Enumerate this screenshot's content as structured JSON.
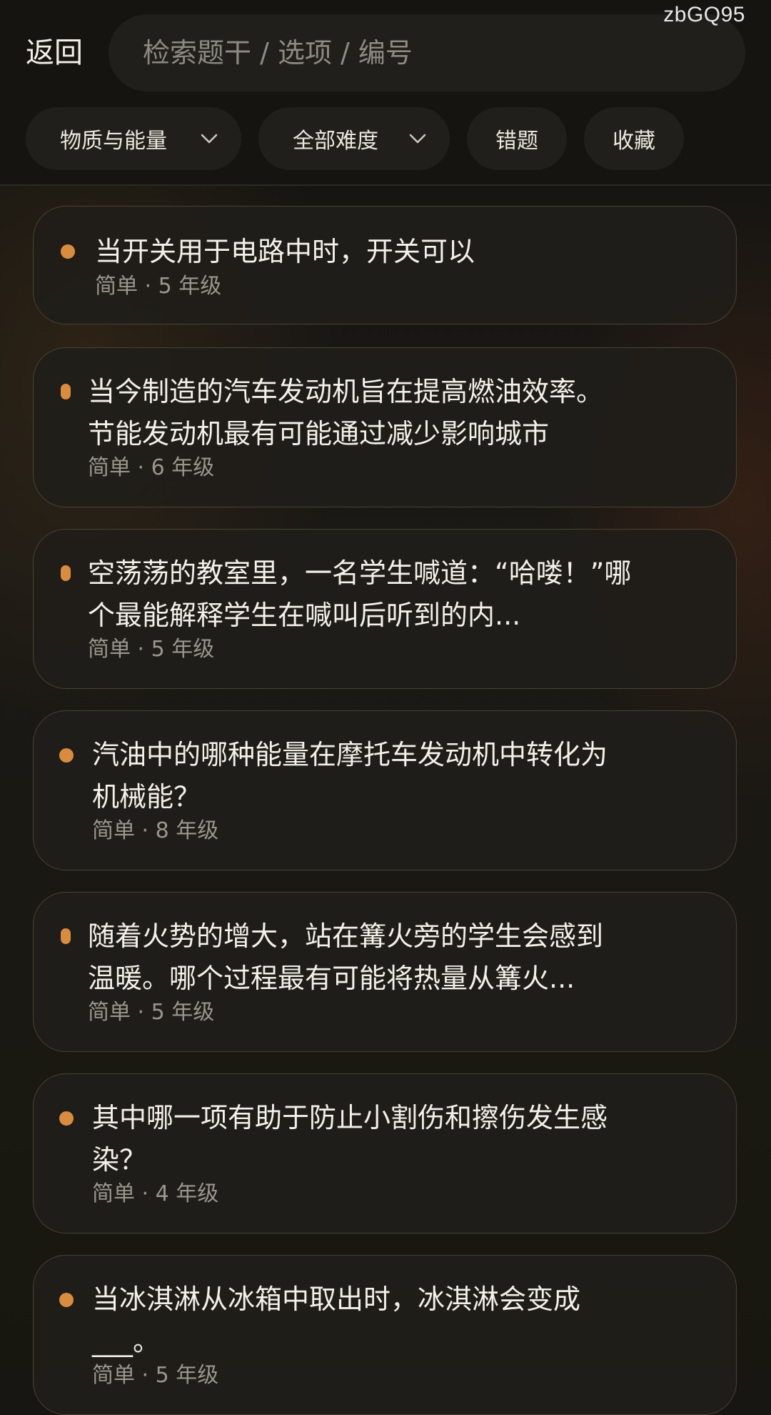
{
  "watermark": "zbGQ95",
  "header": {
    "back_label": "返回",
    "search_placeholder": "检索题干 / 选项 / 编号"
  },
  "filters": {
    "subject": "物质与能量",
    "difficulty": "全部难度",
    "wrong": "错题",
    "favorites": "收藏"
  },
  "questions": [
    {
      "line1": "当开关用于电路中时，开关可以",
      "line2": "",
      "meta": "简单 · 5 年级"
    },
    {
      "line1": "当今制造的汽车发动机旨在提高燃油效率。",
      "line2": "节能发动机最有可能通过减少影响城市",
      "meta": "简单 · 6 年级"
    },
    {
      "line1": "空荡荡的教室里，一名学生喊道：“哈喽！”哪",
      "line2": "个最能解释学生在喊叫后听到的内...",
      "meta": "简单 · 5 年级"
    },
    {
      "line1": "汽油中的哪种能量在摩托车发动机中转化为",
      "line2": "机械能？",
      "meta": "简单 · 8 年级"
    },
    {
      "line1": "随着火势的增大，站在篝火旁的学生会感到",
      "line2": "温暖。哪个过程最有可能将热量从篝火...",
      "meta": "简单 · 5 年级"
    },
    {
      "line1": "其中哪一项有助于防止小割伤和擦伤发生感",
      "line2": "染？",
      "meta": "简单 · 4 年级"
    },
    {
      "line1": "当冰淇淋从冰箱中取出时，冰淇淋会变成",
      "line2": "___。",
      "meta": "简单 · 5 年级"
    }
  ]
}
